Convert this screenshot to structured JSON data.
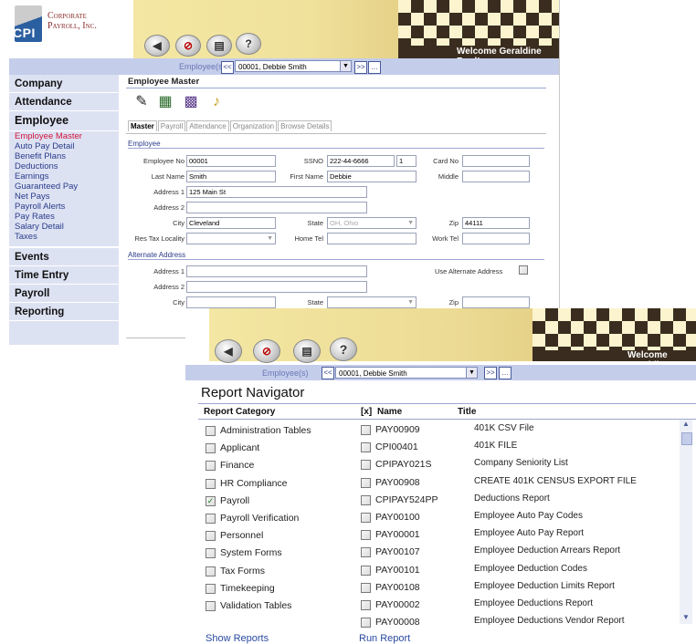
{
  "back_window": {
    "logo_line1": "Corporate",
    "logo_line2": "Payroll, Inc.",
    "logo_abbr": "CPI",
    "welcome": "Welcome Geraldine Ford!",
    "toolbar_icons": [
      "megaphone-icon",
      "no-entry-icon",
      "printer-icon",
      "help-icon"
    ],
    "help_glyph": "?",
    "employee_label": "Employee(s)",
    "employee_selected": "00001, Debbie Smith",
    "nav_prev": "<<",
    "nav_next": ">>",
    "nav": {
      "company": "Company",
      "attendance": "Attendance",
      "employee": "Employee",
      "employee_items": [
        "Employee Master",
        "Auto Pay Detail",
        "Benefit Plans",
        "Deductions",
        "Earnings",
        "Guaranteed Pay",
        "Net Pays",
        "Payroll Alerts",
        "Pay Rates",
        "Salary Detail",
        "Taxes"
      ],
      "events": "Events",
      "time_entry": "Time Entry",
      "payroll": "Payroll",
      "reporting": "Reporting"
    },
    "page_title": "Employee Master",
    "tabs": [
      "Master",
      "Payroll",
      "Attendance",
      "Organization",
      "Browse Details"
    ],
    "section_employee": "Employee",
    "section_alternate": "Alternate Address",
    "labels": {
      "employee_no": "Employee No",
      "ssno": "SSNO",
      "card_no": "Card No",
      "last_name": "Last Name",
      "first_name": "First Name",
      "middle": "Middle",
      "address1": "Address 1",
      "address2": "Address 2",
      "city": "City",
      "state": "State",
      "zip": "Zip",
      "res_tax": "Res Tax Locality",
      "home_tel": "Home Tel",
      "work_tel": "Work Tel",
      "use_alt": "Use Alternate Address"
    },
    "values": {
      "employee_no": "00001",
      "ssno": "222-44-6666",
      "ssno_suffix": "1",
      "card_no": "",
      "last_name": "Smith",
      "first_name": "Debbie",
      "middle": "",
      "address1": "125 Main St",
      "address2": "",
      "city": "Cleveland",
      "state": "OH, Ohio",
      "zip": "44111",
      "res_tax": "",
      "home_tel": "",
      "work_tel": ""
    }
  },
  "front_window": {
    "welcome": "Welcome Geraldi",
    "help_glyph": "?",
    "employee_label": "Employee(s)",
    "employee_selected": "00001, Debbie Smith",
    "nav_prev": "<<",
    "nav_next": ">>",
    "title": "Report Navigator",
    "col_category": "Report Category",
    "col_x": "[x]",
    "col_name": "Name",
    "col_title": "Title",
    "check_mark": "✓",
    "categories": [
      {
        "label": "Administration Tables",
        "checked": false
      },
      {
        "label": "Applicant",
        "checked": false
      },
      {
        "label": "Finance",
        "checked": false
      },
      {
        "label": "HR Compliance",
        "checked": false
      },
      {
        "label": "Payroll",
        "checked": true
      },
      {
        "label": "Payroll Verification",
        "checked": false
      },
      {
        "label": "Personnel",
        "checked": false
      },
      {
        "label": "System Forms",
        "checked": false
      },
      {
        "label": "Tax Forms",
        "checked": false
      },
      {
        "label": "Timekeeping",
        "checked": false
      },
      {
        "label": "Validation Tables",
        "checked": false
      }
    ],
    "reports": [
      {
        "name": "PAY00909",
        "title": "401K CSV File"
      },
      {
        "name": "CPI00401",
        "title": "401K FILE"
      },
      {
        "name": "CPIPAY021S",
        "title": "Company Seniority List"
      },
      {
        "name": "PAY00908",
        "title": "CREATE 401K CENSUS EXPORT FILE"
      },
      {
        "name": "CPIPAY524PP",
        "title": "Deductions Report"
      },
      {
        "name": "PAY00100",
        "title": "Employee Auto Pay Codes"
      },
      {
        "name": "PAY00001",
        "title": "Employee Auto Pay Report"
      },
      {
        "name": "PAY00107",
        "title": "Employee Deduction Arrears Report"
      },
      {
        "name": "PAY00101",
        "title": "Employee Deduction Codes"
      },
      {
        "name": "PAY00108",
        "title": "Employee Deduction Limits Report"
      },
      {
        "name": "PAY00002",
        "title": "Employee Deductions Report"
      },
      {
        "name": "PAY00008",
        "title": "Employee Deductions Vendor Report"
      }
    ],
    "show_reports": "Show Reports",
    "run_report": "Run Report"
  }
}
